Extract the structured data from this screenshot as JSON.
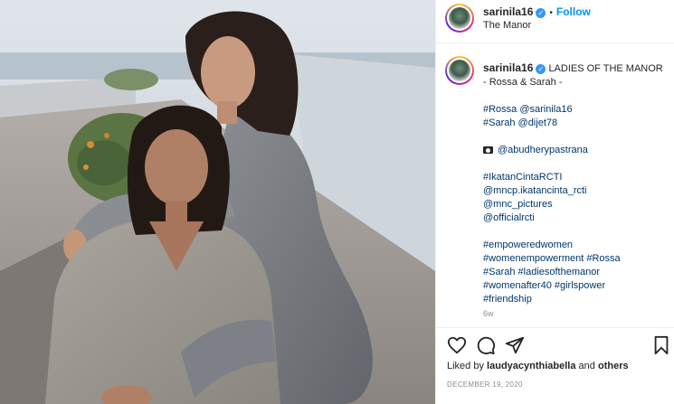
{
  "post": {
    "username": "sarinila16",
    "follow_label": "Follow",
    "location": "The Manor",
    "caption": {
      "title": "LADIES OF THE MANOR",
      "subtitle": "- Rossa & Sarah -",
      "l1": "#Rossa @sarinila16",
      "l2": "#Sarah @dijet78",
      "l3": "@abudherypastrana",
      "l4": "#IkatanCintaRCTI",
      "l5": "@mncp.ikatancinta_rcti",
      "l6": "@mnc_pictures",
      "l7": "@officialrcti",
      "l8": "#empoweredwomen",
      "l9": "#womenempowerment #Rossa",
      "l10": "#Sarah #ladiesofthemanor",
      "l11": "#womenafter40 #girlspower",
      "l12": "#friendship"
    },
    "age": "6w",
    "liked_by_prefix": "Liked by",
    "liked_by_user": "laudyacynthiabella",
    "liked_by_and": "and",
    "liked_by_others": "others",
    "date": "DECEMBER 19, 2020"
  },
  "icons": {
    "verified": "verified-badge",
    "heart": "heart-icon",
    "comment": "comment-icon",
    "share": "share-icon",
    "save": "bookmark-icon",
    "camera": "camera-icon"
  },
  "colors": {
    "link": "#0095f6",
    "hashtag": "#00376b",
    "muted": "#8e8e8e",
    "verified": "#3897f0"
  }
}
